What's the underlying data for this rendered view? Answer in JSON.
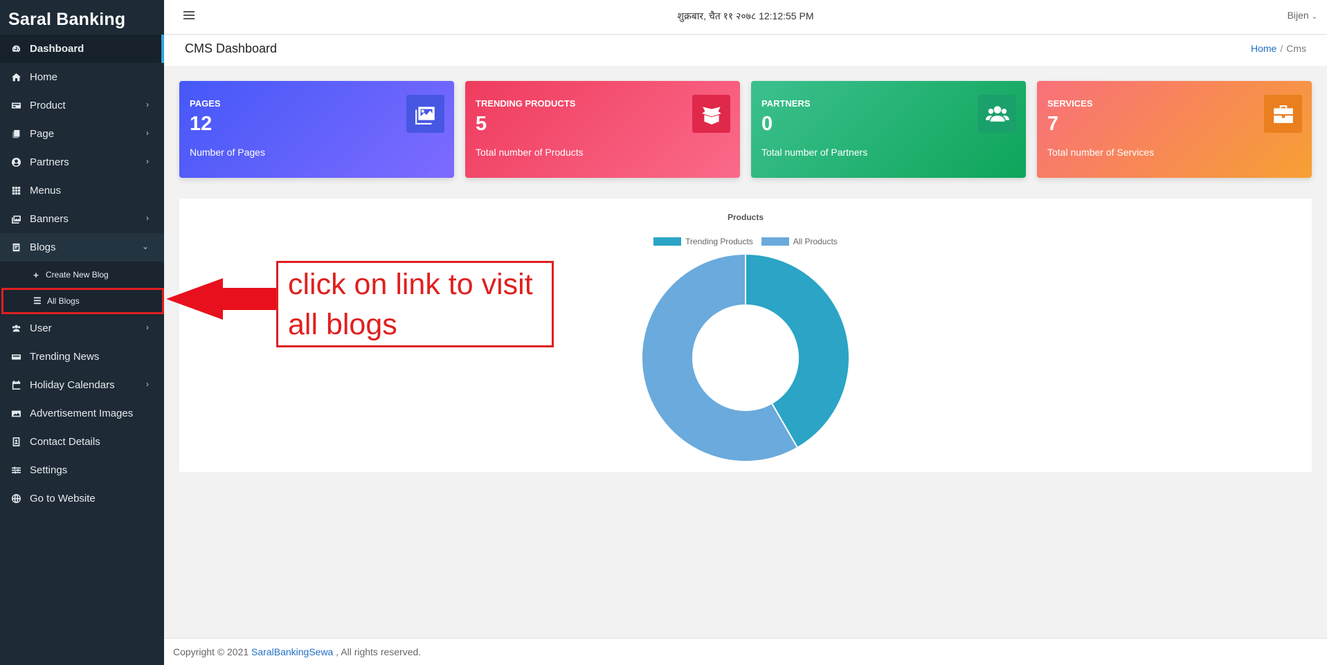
{
  "brand": "Saral Banking",
  "sidebar": {
    "items": [
      {
        "label": "Dashboard",
        "icon": "dashboard-icon"
      },
      {
        "label": "Home",
        "icon": "home-icon"
      },
      {
        "label": "Product",
        "icon": "product-icon"
      },
      {
        "label": "Page",
        "icon": "page-icon"
      },
      {
        "label": "Partners",
        "icon": "partners-icon"
      },
      {
        "label": "Menus",
        "icon": "menus-icon"
      },
      {
        "label": "Banners",
        "icon": "banners-icon"
      },
      {
        "label": "Blogs",
        "icon": "blogs-icon"
      },
      {
        "label": "User",
        "icon": "user-icon"
      },
      {
        "label": "Trending News",
        "icon": "news-icon"
      },
      {
        "label": "Holiday Calendars",
        "icon": "calendar-icon"
      },
      {
        "label": "Advertisement Images",
        "icon": "image-icon"
      },
      {
        "label": "Contact Details",
        "icon": "contact-icon"
      },
      {
        "label": "Settings",
        "icon": "settings-icon"
      },
      {
        "label": "Go to Website",
        "icon": "globe-icon"
      }
    ],
    "blog_sub": [
      {
        "label": "Create New Blog",
        "icon": "plus-icon"
      },
      {
        "label": "All Blogs",
        "icon": "list-icon"
      }
    ]
  },
  "topbar": {
    "datetime": "शुक्रबार, चैत ११ २०७८  12:12:55 PM",
    "user": "Bijen"
  },
  "header": {
    "title": "CMS Dashboard",
    "breadcrumb_home": "Home",
    "breadcrumb_sep": "/",
    "breadcrumb_current": "Cms"
  },
  "cards": [
    {
      "label": "PAGES",
      "value": "12",
      "desc": "Number of Pages",
      "icon": "images-icon",
      "color": "#4558f8"
    },
    {
      "label": "TRENDING PRODUCTS",
      "value": "5",
      "desc": "Total number of Products",
      "icon": "box-open-icon",
      "color": "#ef3c5e"
    },
    {
      "label": "PARTNERS",
      "value": "0",
      "desc": "Total number of Partners",
      "icon": "users-icon",
      "color": "#1aa06a"
    },
    {
      "label": "SERVICES",
      "value": "7",
      "desc": "Total number of Services",
      "icon": "briefcase-icon",
      "color": "#f7a033"
    }
  ],
  "chart_data": {
    "type": "pie",
    "title": "Products",
    "categories": [
      "Trending Products",
      "All Products"
    ],
    "values": [
      5,
      7
    ],
    "colors": [
      "#2ba4c6",
      "#6aaadc"
    ],
    "legend": "top"
  },
  "annotation": {
    "line1": "click on link to visit",
    "line2": "all blogs",
    "color": "#e02020"
  },
  "footer": {
    "prefix": "Copyright © 2021 ",
    "link": "SaralBankingSewa",
    "suffix": " , All rights reserved."
  }
}
